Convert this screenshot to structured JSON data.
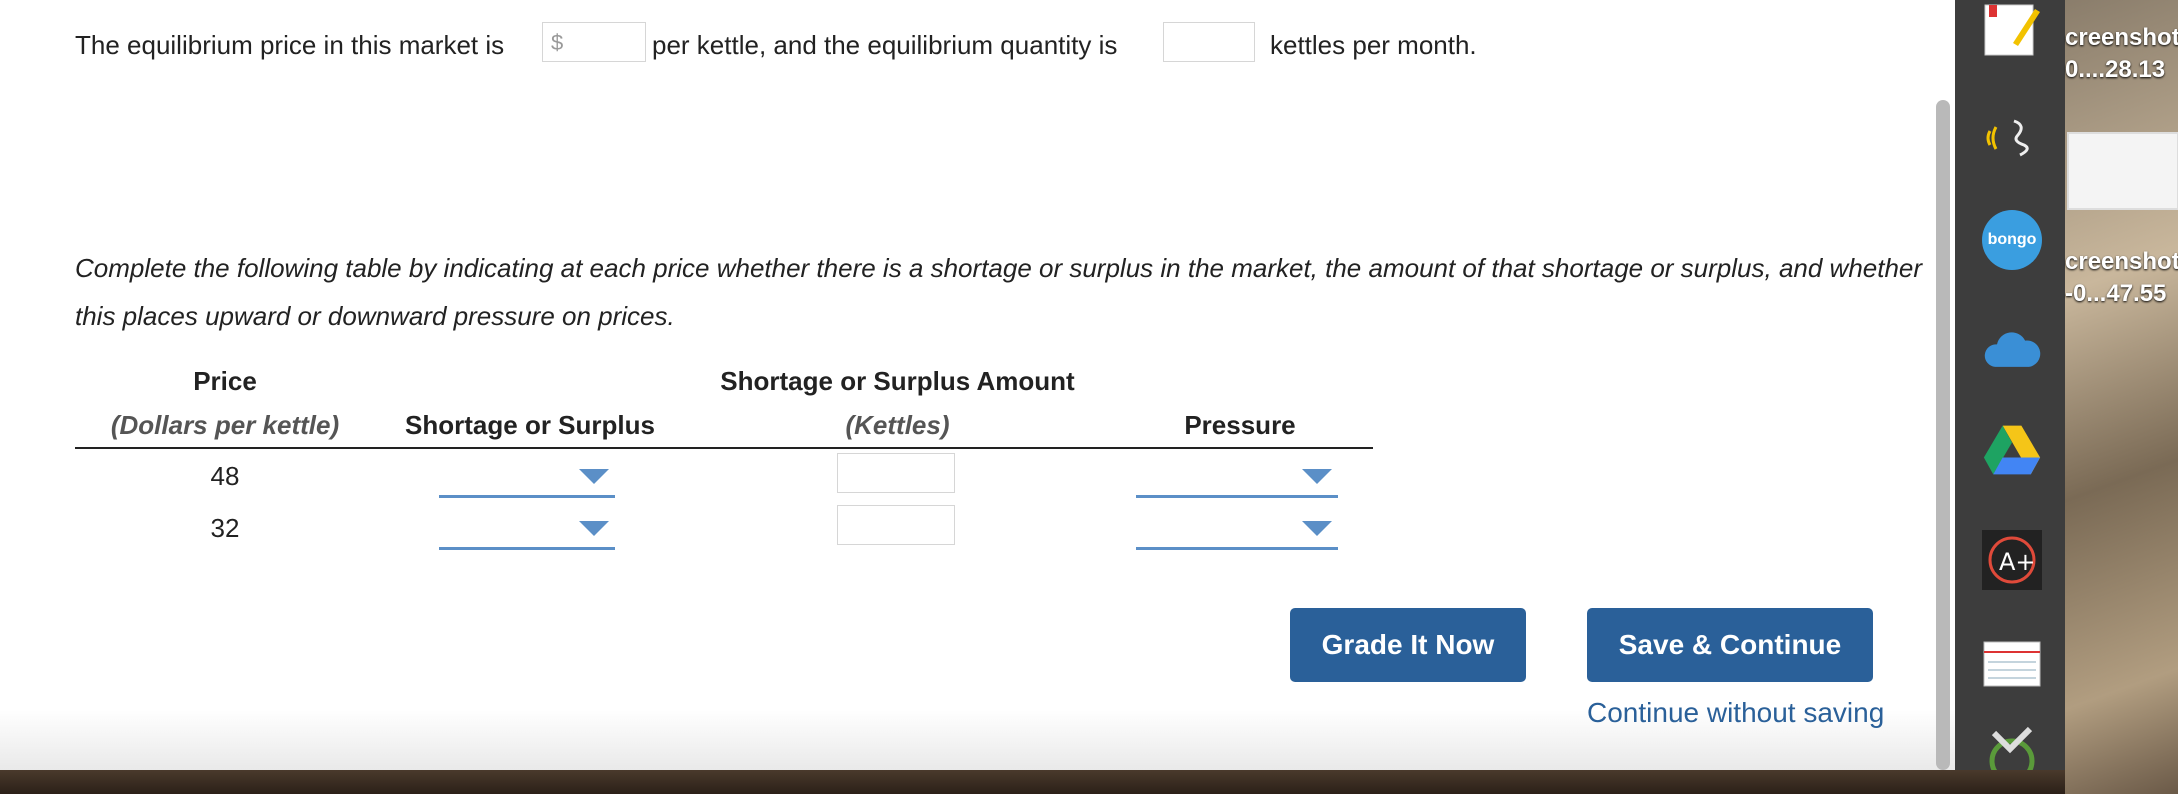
{
  "question": {
    "part1": "The equilibrium price in this market is",
    "currency_prefix": "$",
    "part2": "per kettle, and the equilibrium quantity is",
    "part3": "kettles per month."
  },
  "instruction": "Complete the following table by indicating at each price whether there is a shortage or surplus in the market, the amount of that shortage or surplus, and whether this places upward or downward pressure on prices.",
  "table": {
    "headers": {
      "price": "Price",
      "price_unit": "(Dollars per kettle)",
      "shortage_surplus": "Shortage or Surplus",
      "amount": "Shortage or Surplus Amount",
      "amount_unit": "(Kettles)",
      "pressure": "Pressure"
    },
    "rows": [
      {
        "price": "48",
        "shortage_surplus": "",
        "amount": "",
        "pressure": ""
      },
      {
        "price": "32",
        "shortage_surplus": "",
        "amount": "",
        "pressure": ""
      }
    ]
  },
  "buttons": {
    "grade": "Grade It Now",
    "save": "Save & Continue",
    "continue_link": "Continue without saving"
  },
  "dock": {
    "icons": [
      "notes-pencil-icon",
      "sound-wave-icon",
      "bongo-icon",
      "cloud-icon",
      "google-drive-icon",
      "a-plus-icon",
      "notecards-icon",
      "checkmark-icon"
    ],
    "bongo_label": "bongo"
  },
  "desktop": {
    "file1_line1": "creenshot",
    "file1_line2": "0....28.13",
    "file2_line1": "creenshot",
    "file2_line2": "-0...47.55"
  },
  "colors": {
    "accent": "#2a6099",
    "dropdown": "#5b8fc7"
  }
}
